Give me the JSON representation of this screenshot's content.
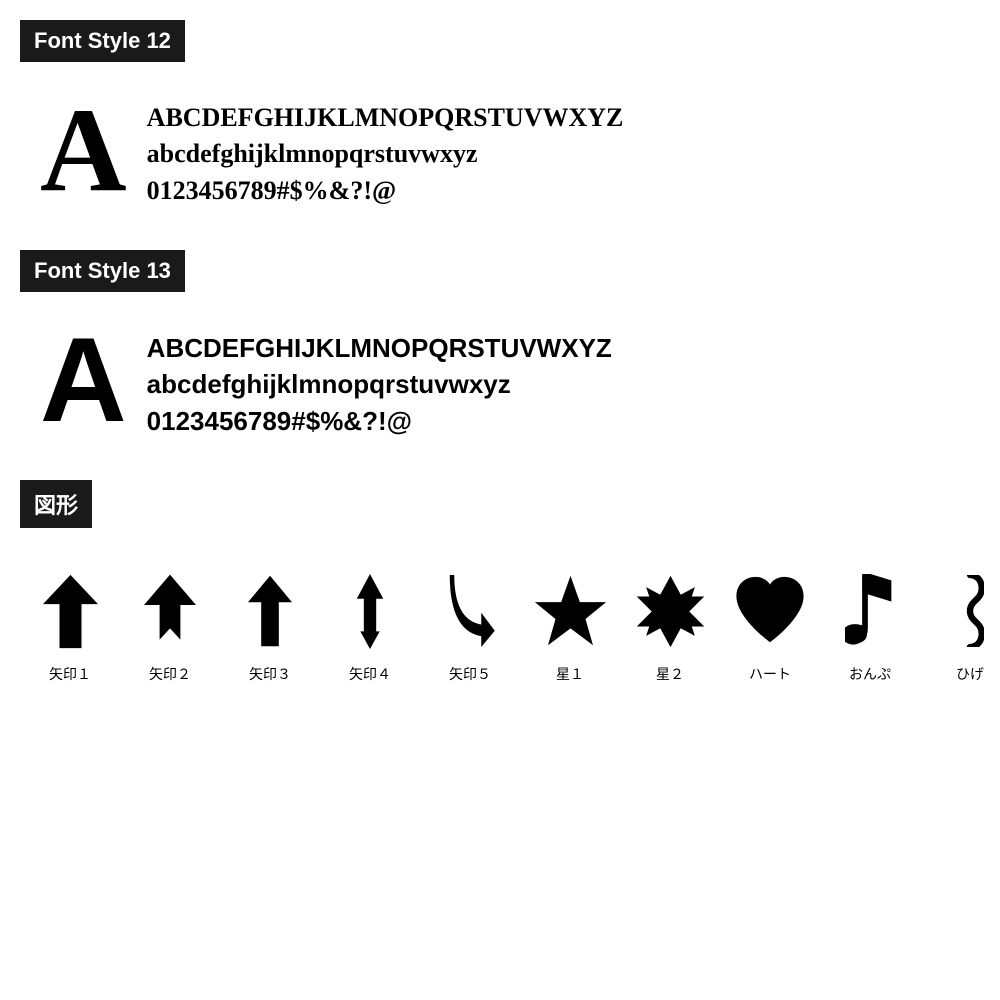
{
  "font_style_12": {
    "header": "Font Style 12",
    "big_letter": "A",
    "lines": [
      "ABCDEFGHIJKLMNOPQRSTUVWXYZ",
      "abcdefghijklmnopqrstuvwxyz",
      "0123456789#$%&?!@"
    ]
  },
  "font_style_13": {
    "header": "Font Style 13",
    "big_letter": "A",
    "lines": [
      "ABCDEFGHIJKLMNOPQRSTUVWXYZ",
      "abcdefghijklmnopqrstuvwxyz",
      "0123456789#$%&?!@"
    ]
  },
  "shapes_section": {
    "header": "図形",
    "shapes": [
      {
        "name": "yajirushi1",
        "label": "矢印１"
      },
      {
        "name": "yajirushi2",
        "label": "矢印２"
      },
      {
        "name": "yajirushi3",
        "label": "矢印３"
      },
      {
        "name": "yajirushi4",
        "label": "矢印４"
      },
      {
        "name": "yajirushi5",
        "label": "矢印５"
      },
      {
        "name": "hoshi1",
        "label": "星１"
      },
      {
        "name": "hoshi2",
        "label": "星２"
      },
      {
        "name": "heart",
        "label": "ハート"
      },
      {
        "name": "onpu",
        "label": "おんぷ"
      },
      {
        "name": "hige",
        "label": "ひげ"
      }
    ]
  }
}
